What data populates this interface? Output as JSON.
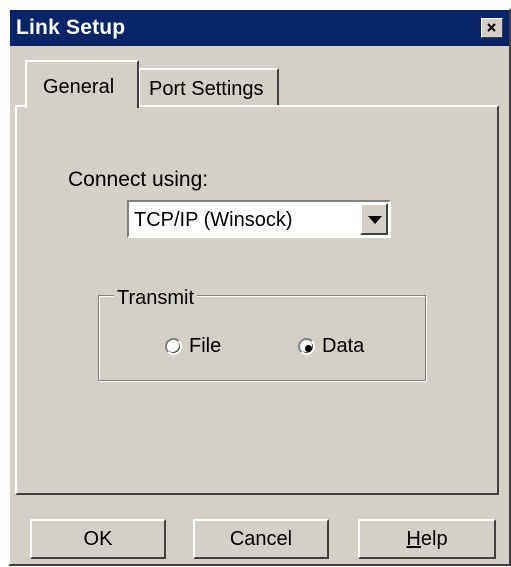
{
  "window": {
    "title": "Link Setup",
    "close_icon": "close-icon"
  },
  "tabs": [
    {
      "label": "General",
      "active": true
    },
    {
      "label": "Port Settings",
      "active": false
    }
  ],
  "general": {
    "connect_label": "Connect using:",
    "connect_value": "TCP/IP (Winsock)",
    "transmit": {
      "legend": "Transmit",
      "options": [
        {
          "label": "File",
          "selected": false
        },
        {
          "label": "Data",
          "selected": true
        }
      ]
    }
  },
  "buttons": {
    "ok": "OK",
    "cancel": "Cancel",
    "help": "Help"
  },
  "colors": {
    "titlebar": "#0a246a",
    "face": "#d4d0c8"
  }
}
